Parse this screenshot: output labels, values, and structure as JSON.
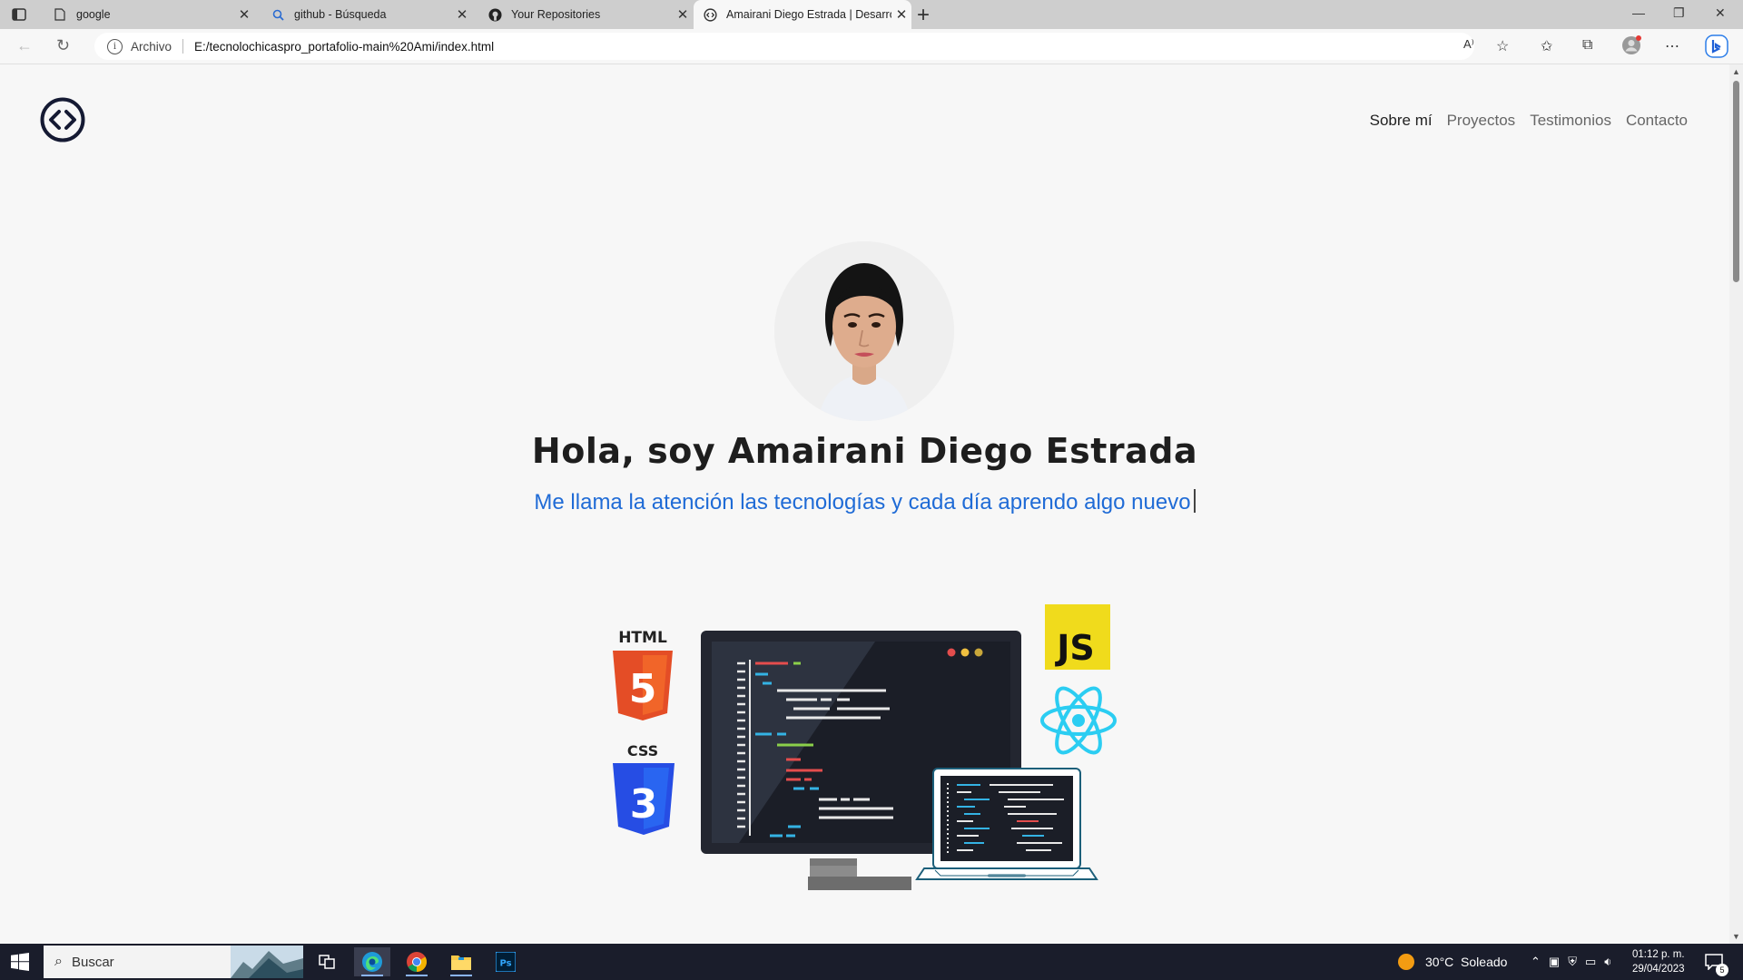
{
  "browser": {
    "tabs": [
      {
        "title": "google",
        "icon": "page-icon"
      },
      {
        "title": "github - Búsqueda",
        "icon": "search-icon"
      },
      {
        "title": "Your Repositories",
        "icon": "github-icon"
      },
      {
        "title": "Amairani Diego Estrada | Desarro",
        "icon": "site-icon",
        "active": true
      }
    ],
    "address": {
      "label": "Archivo",
      "url": "E:/tecnolochicaspro_portafolio-main%20Ami/index.html"
    }
  },
  "page": {
    "nav": [
      {
        "label": "Sobre mí",
        "active": true
      },
      {
        "label": "Proyectos"
      },
      {
        "label": "Testimonios"
      },
      {
        "label": "Contacto"
      }
    ],
    "hero": {
      "title": "Hola, soy Amairani Diego Estrada",
      "subtitle": "Me llama la atención las tecnologías y cada día aprendo algo nuevo"
    },
    "illustration": {
      "html_label": "HTML",
      "css_label": "CSS",
      "js_label": "JS",
      "html_digit": "5",
      "css_digit": "3"
    },
    "colors": {
      "accent": "#1f6bd6",
      "footer": "#151a33",
      "background": "#f7f7f7"
    }
  },
  "taskbar": {
    "search_placeholder": "Buscar",
    "weather": "30°C  Soleado",
    "time": "01:12 p. m.",
    "date": "29/04/2023",
    "notifications": "5"
  }
}
